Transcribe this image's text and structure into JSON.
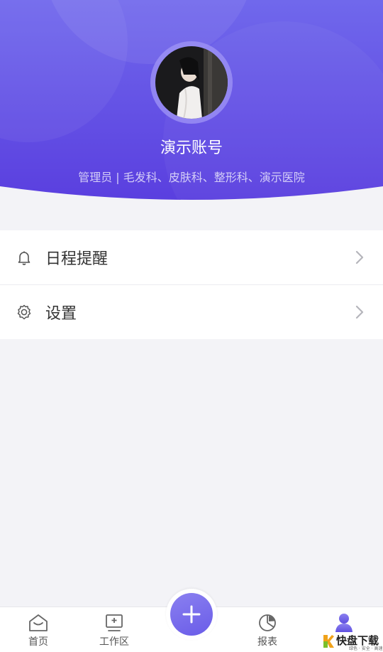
{
  "header": {
    "account_name": "演示账号",
    "account_role": "管理员 | 毛发科、皮肤科、整形科、演示医院",
    "gradient_top": "#6e63ea",
    "gradient_bottom": "#5b3fe0"
  },
  "menu": {
    "items": [
      {
        "label": "日程提醒",
        "icon": "bell-icon"
      },
      {
        "label": "设置",
        "icon": "gear-icon"
      }
    ]
  },
  "tabbar": {
    "tabs": [
      {
        "label": "首页",
        "icon": "home-icon"
      },
      {
        "label": "工作区",
        "icon": "workspace-icon"
      },
      {
        "label": "报表",
        "icon": "pie-chart-icon"
      },
      {
        "label": "",
        "icon": "profile-icon",
        "active": true
      }
    ],
    "fab_icon": "plus-icon",
    "accent": "#6f62e8"
  },
  "watermark": {
    "text": "快盘下载",
    "sub": "绿色 · 安全 · 高速"
  }
}
